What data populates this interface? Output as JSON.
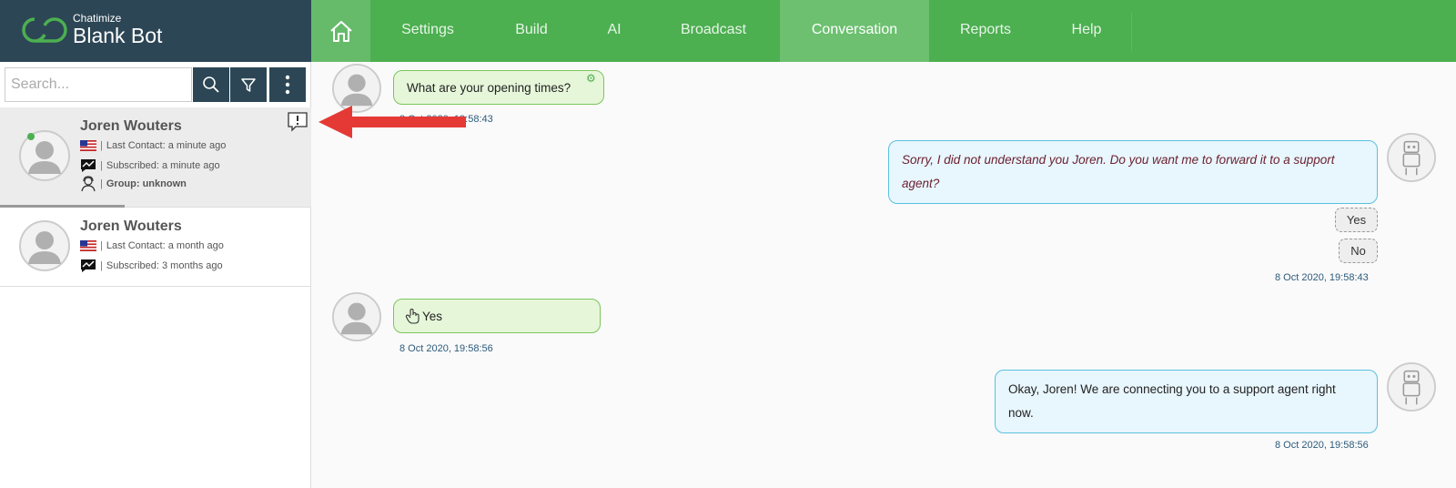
{
  "brand": {
    "company": "Chatimize",
    "bot_name": "Blank Bot"
  },
  "nav": {
    "items": [
      "Settings",
      "Build",
      "AI",
      "Broadcast",
      "Conversation",
      "Reports",
      "Help"
    ],
    "active": "Conversation"
  },
  "search": {
    "placeholder": "Search..."
  },
  "contacts": [
    {
      "name": "Joren Wouters",
      "last_contact": "Last Contact: a minute ago",
      "subscribed": "Subscribed: a minute ago",
      "group": "Group: unknown",
      "online": true,
      "selected": true
    },
    {
      "name": "Joren Wouters",
      "last_contact": "Last Contact: a month ago",
      "subscribed": "Subscribed: 3 months ago"
    }
  ],
  "messages": {
    "m1": {
      "text": "What are your opening times?",
      "time": "8 Oct 2020, 19:58:43"
    },
    "m2": {
      "text": "Sorry, I did not understand you Joren. Do you want me to forward it to a support agent?",
      "options": [
        "Yes",
        "No"
      ],
      "time": "8 Oct 2020, 19:58:43"
    },
    "m3": {
      "text": "Yes",
      "time": "8 Oct 2020, 19:58:56"
    },
    "m4": {
      "text": "Okay, Joren! We are connecting you to a support agent right now.",
      "time": "8 Oct 2020, 19:58:56"
    }
  },
  "colors": {
    "nav_green": "#4caf50",
    "sidebar_dark": "#2c4655",
    "user_bubble": "#e6f6d9",
    "bot_bubble": "#e8f6fd",
    "arrow": "#e53935"
  }
}
